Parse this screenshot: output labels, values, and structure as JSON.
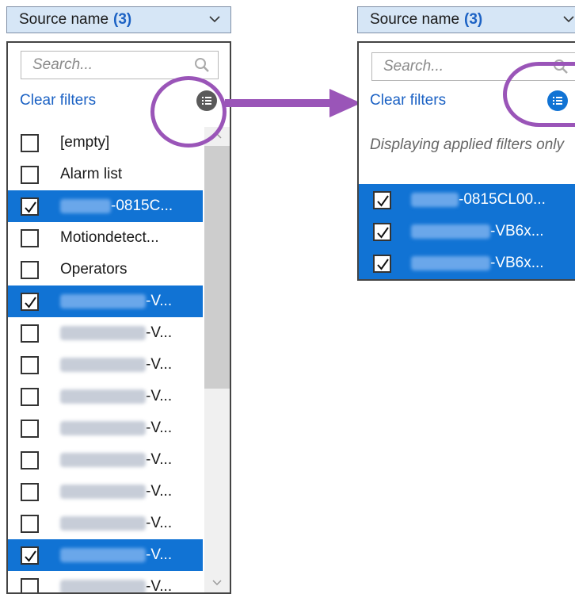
{
  "left_panel": {
    "header": {
      "title": "Source name",
      "count": "(3)"
    },
    "search": {
      "placeholder": "Search..."
    },
    "clear_filters": "Clear filters",
    "items": [
      {
        "label": "[empty]",
        "checked": false,
        "blur_width": 0
      },
      {
        "label": "Alarm list",
        "checked": false,
        "blur_width": 0
      },
      {
        "label": "-0815C...",
        "checked": true,
        "blur_width": 64
      },
      {
        "label": "Motiondetect...",
        "checked": false,
        "blur_width": 0
      },
      {
        "label": "Operators",
        "checked": false,
        "blur_width": 0
      },
      {
        "label": "-V...",
        "checked": true,
        "blur_width": 108
      },
      {
        "label": "-V...",
        "checked": false,
        "blur_width": 108
      },
      {
        "label": "-V...",
        "checked": false,
        "blur_width": 108
      },
      {
        "label": "-V...",
        "checked": false,
        "blur_width": 108
      },
      {
        "label": "-V...",
        "checked": false,
        "blur_width": 108
      },
      {
        "label": "-V...",
        "checked": false,
        "blur_width": 108
      },
      {
        "label": "-V...",
        "checked": false,
        "blur_width": 108
      },
      {
        "label": "-V...",
        "checked": false,
        "blur_width": 108
      },
      {
        "label": "-V...",
        "checked": true,
        "blur_width": 108
      },
      {
        "label": "-V...",
        "checked": false,
        "blur_width": 108
      }
    ]
  },
  "right_panel": {
    "header": {
      "title": "Source name",
      "count": "(3)"
    },
    "search": {
      "placeholder": "Search..."
    },
    "clear_filters": "Clear filters",
    "note": "Displaying applied filters only",
    "items": [
      {
        "label": "-0815CL00...",
        "checked": true,
        "blur_width": 60
      },
      {
        "label": "-VB6x...",
        "checked": true,
        "blur_width": 100
      },
      {
        "label": "-VB6x...",
        "checked": true,
        "blur_width": 100
      }
    ]
  },
  "colors": {
    "selection": "#1173d4",
    "link": "#1c62c4",
    "highlight_ring": "#9a55b8",
    "header_bg": "#d6e6f6"
  },
  "icons": [
    "chevron-down-icon",
    "search-icon",
    "filter-list-icon",
    "checkmark-icon",
    "arrow-right-icon"
  ]
}
